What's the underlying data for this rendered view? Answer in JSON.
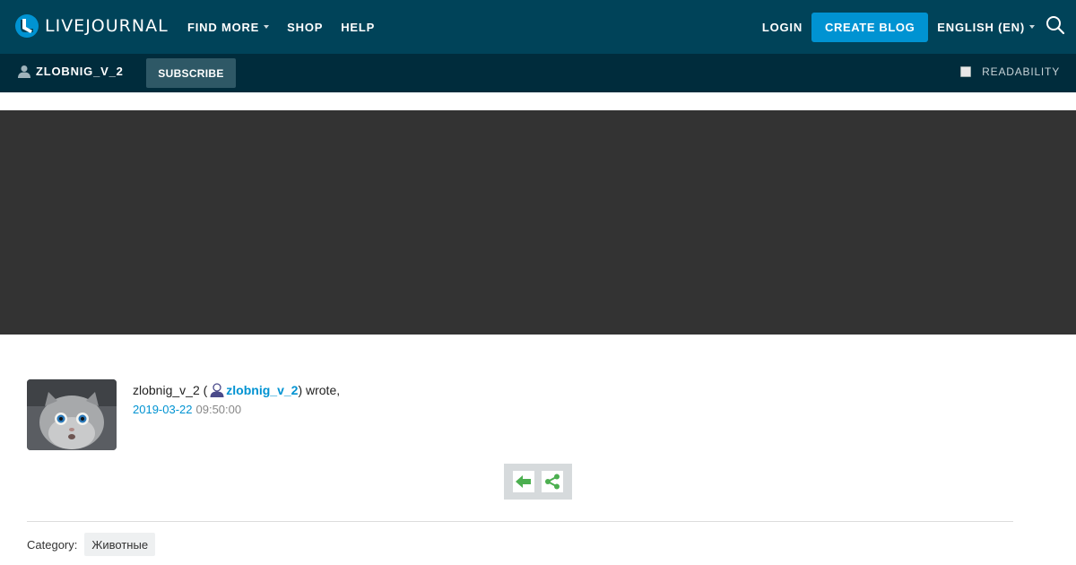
{
  "header": {
    "logo_text": "LIVEJOURNAL",
    "nav": [
      {
        "label": "FIND MORE",
        "has_dropdown": true
      },
      {
        "label": "SHOP",
        "has_dropdown": false
      },
      {
        "label": "HELP",
        "has_dropdown": false
      }
    ],
    "login_label": "LOGIN",
    "create_blog_label": "CREATE BLOG",
    "language_label": "ENGLISH (EN)",
    "search_icon": "search-icon"
  },
  "subbar": {
    "username": "ZLOBNIG_V_2",
    "subscribe_label": "SUBSCRIBE",
    "readability_label": "READABILITY",
    "readability_checked": false
  },
  "post": {
    "author_name": "zlobnig_v_2",
    "open_paren": " (",
    "journal_name": "zlobnig_v_2",
    "wrote_text": ") wrote,",
    "date": "2019-03-22",
    "time": "09:50:00",
    "category_label": "Category:",
    "category_tag": "Животные"
  },
  "actions": {
    "reply_icon": "reply-arrow-icon",
    "share_icon": "share-icon"
  },
  "colors": {
    "topbar": "#004359",
    "subbar": "#002c3c",
    "accent": "#0093d2",
    "banner": "#333333",
    "action_green": "#4caf50"
  }
}
